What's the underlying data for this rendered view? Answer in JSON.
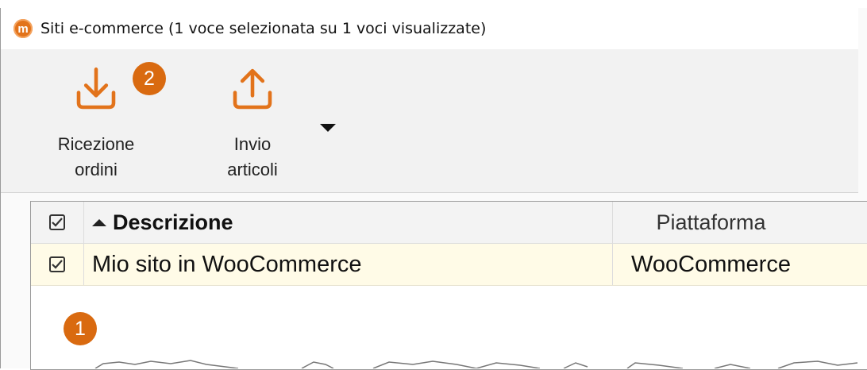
{
  "window": {
    "title": "Siti e-commerce (1 voce selezionata su 1 voci visualizzate)",
    "app_icon": "m"
  },
  "toolbar": {
    "receive_orders": {
      "line1": "Ricezione",
      "line2": "ordini",
      "icon": "download-icon"
    },
    "send_items": {
      "line1": "Invio",
      "line2": "articoli",
      "icon": "upload-icon"
    },
    "more_icon": "dropdown-arrow-icon"
  },
  "badges": {
    "one": "1",
    "two": "2"
  },
  "grid": {
    "columns": {
      "description": "Descrizione",
      "platform": "Piattaforma"
    },
    "rows": [
      {
        "checked": true,
        "description": "Mio sito in WooCommerce",
        "platform": "WooCommerce"
      }
    ]
  },
  "colors": {
    "accent": "#e2731b",
    "badge": "#d96a10",
    "selected_row": "#fffbe7"
  }
}
